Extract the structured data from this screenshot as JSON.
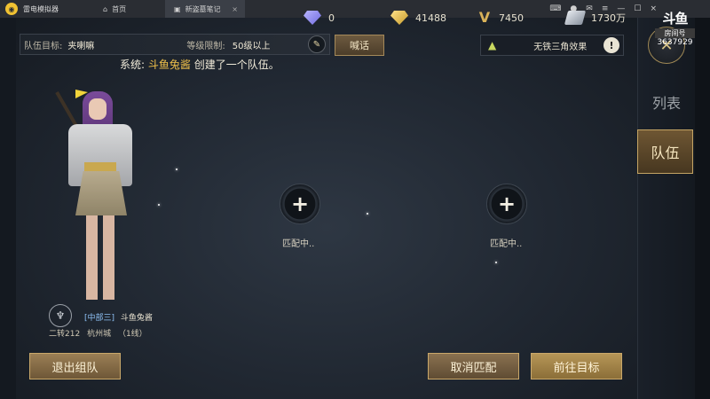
{
  "emulator": {
    "app_name": "雷电模拟器",
    "tabs": [
      {
        "label": "首页"
      },
      {
        "label": "新盗墓笔记"
      }
    ]
  },
  "currencies": [
    {
      "icon": "diamond-icon",
      "value": "0"
    },
    {
      "icon": "gold-ingot-icon",
      "value": "41488"
    },
    {
      "icon": "v-points-icon",
      "value": "7450"
    },
    {
      "icon": "silver-icon",
      "value": "1730万"
    }
  ],
  "team_target": {
    "label": "队伍目标:",
    "value": "夹喇嘛",
    "level_label": "等级限制:",
    "level_value": "50级以上"
  },
  "shout_button": "喊话",
  "effect": {
    "text": "无铁三角效果",
    "warn": "!"
  },
  "system_message": {
    "prefix": "系统:",
    "name": "斗鱼兔酱",
    "text": "创建了一个队伍。"
  },
  "player": {
    "guild": "[中部三]",
    "name": "斗鱼兔酱",
    "class_level": "二转212",
    "location": "杭州城",
    "line": "（1线）"
  },
  "slots": [
    {
      "symbol": "+",
      "label": "匹配中.."
    },
    {
      "symbol": "+",
      "label": "匹配中.."
    }
  ],
  "buttons": {
    "leave": "退出组队",
    "cancel": "取消匹配",
    "go": "前往目标"
  },
  "right_panel": {
    "tab_list": "列表",
    "tab_team": "队伍"
  },
  "watermark": {
    "logo": "斗鱼",
    "label": "房间号",
    "room_id": "3637929"
  }
}
